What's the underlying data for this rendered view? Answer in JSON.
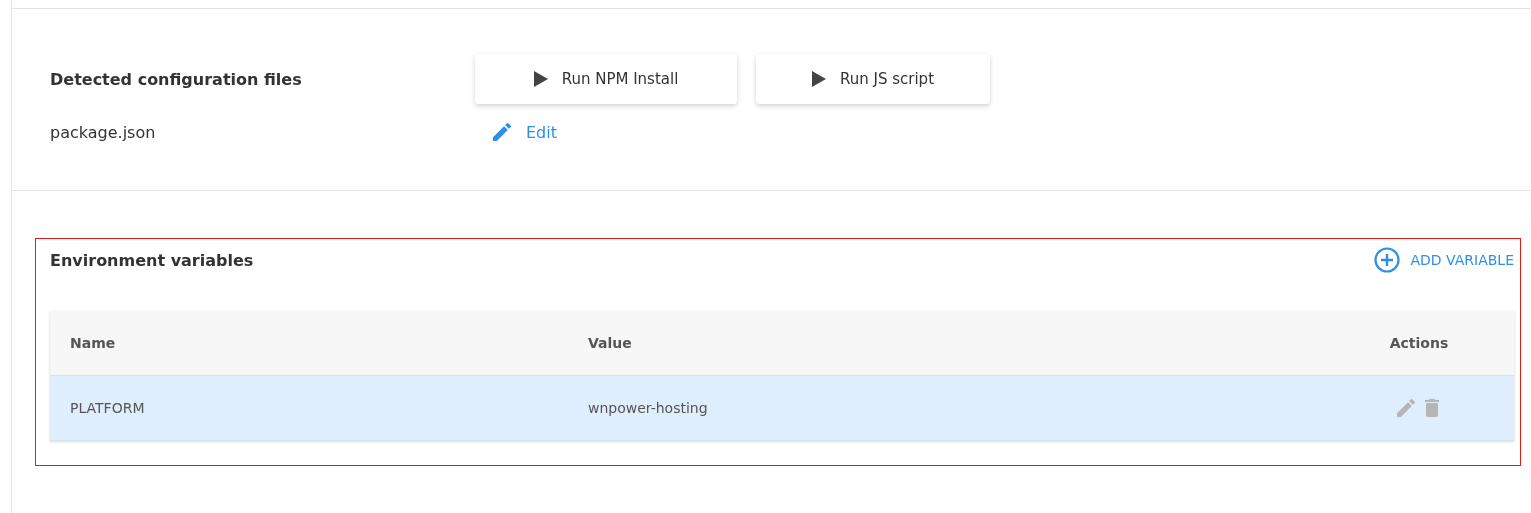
{
  "config_section": {
    "title": "Detected configuration files",
    "actions": [
      {
        "label": "Run NPM Install"
      },
      {
        "label": "Run JS script"
      }
    ],
    "files": [
      {
        "name": "package.json",
        "action": "Edit"
      }
    ]
  },
  "env_section": {
    "highlighted": true,
    "title": "Environment variables",
    "add_button": "ADD VARIABLE",
    "table": {
      "columns": [
        "Name",
        "Value",
        "Actions"
      ],
      "rows": [
        {
          "name": "PLATFORM",
          "value": "wnpower-hosting",
          "selected": true
        }
      ]
    }
  }
}
